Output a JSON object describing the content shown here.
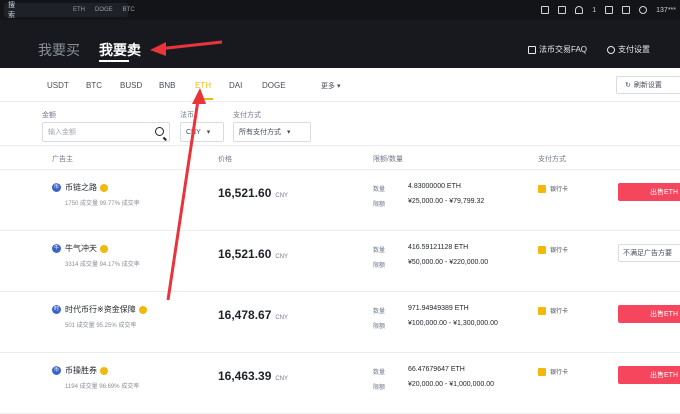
{
  "topbar": {
    "search_label": "搜索",
    "chips": [
      "ETH",
      "DOGE",
      "BTC"
    ],
    "account": "137***"
  },
  "header": {
    "tab_buy": "我要买",
    "tab_sell": "我要卖",
    "faq": "法币交易FAQ",
    "pay_settings": "支付设置"
  },
  "coins": {
    "items": [
      "USDT",
      "BTC",
      "BUSD",
      "BNB",
      "ETH",
      "DAI",
      "DOGE"
    ],
    "active": "ETH",
    "more": "更多",
    "refresh": "刷新设置"
  },
  "filters": {
    "amount_label": "金额",
    "amount_placeholder": "输入金额",
    "fiat_label": "法币",
    "fiat_value": "CNY",
    "pay_label": "支付方式",
    "pay_value": "所有支付方式"
  },
  "table": {
    "headers": {
      "advertiser": "广告主",
      "price": "价格",
      "limit": "限额/数量",
      "payment": "支付方式"
    },
    "qty_label": "数量",
    "limit_label": "限额",
    "currency": "CNY",
    "rows": [
      {
        "name": "币链之路",
        "stats": "1750 成交量 99.77% 成交率",
        "price": "16,521.60",
        "qty": "4.83000000 ETH",
        "limit": "¥25,000.00 - ¥79,799.32",
        "payment": "银行卡",
        "action": "出售ETH"
      },
      {
        "name": "牛气冲天",
        "stats": "3314 成交量 94.17% 成交率",
        "price": "16,521.60",
        "qty": "416.59121128 ETH",
        "limit": "¥50,000.00 - ¥220,000.00",
        "payment": "银行卡",
        "action": "不满足广告方要"
      },
      {
        "name": "时代币行※资金保障",
        "stats": "501 成交量 95.25% 成交率",
        "price": "16,478.67",
        "qty": "971.94949389 ETH",
        "limit": "¥100,000.00 - ¥1,300,000.00",
        "payment": "银行卡",
        "action": "出售ETH"
      },
      {
        "name": "币操胜券",
        "stats": "1194 成交量 96.69% 成交率",
        "price": "16,463.39",
        "qty": "66.47679647 ETH",
        "limit": "¥20,000.00 - ¥1,000,000.00",
        "payment": "银行卡",
        "action": "出售ETH"
      }
    ]
  },
  "colors": {
    "accent": "#f0b90b",
    "sell": "#f6465d",
    "annotation_arrow": "#e8343a"
  }
}
